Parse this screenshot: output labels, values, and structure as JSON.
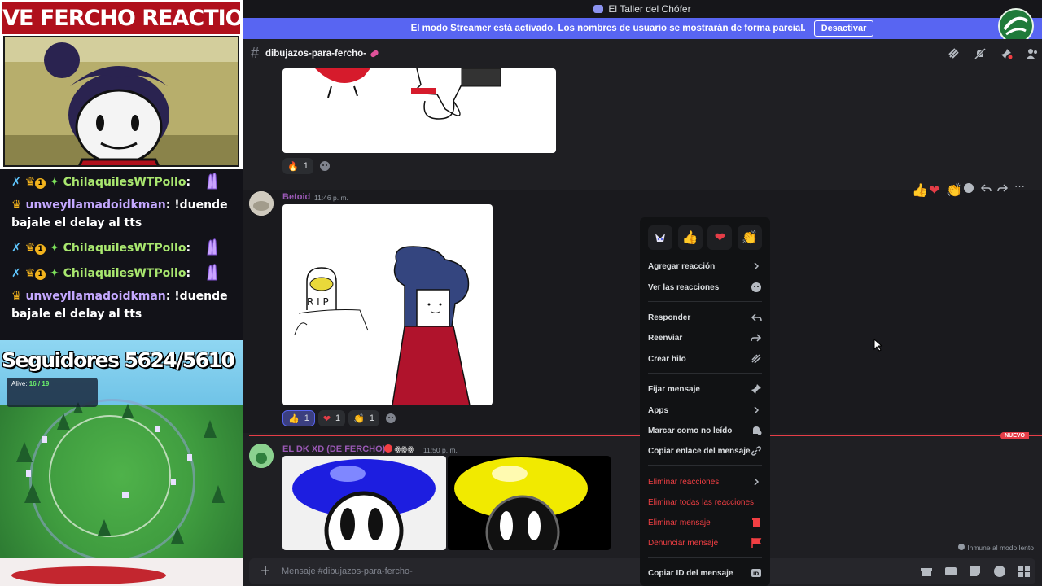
{
  "overlay": {
    "title": "LIVE FERCHO REACTION",
    "chat": [
      {
        "user": "ChilaquilesWTPollo",
        "message": "",
        "badges": "sword-crown-1-diamond"
      },
      {
        "user": "unweyllamadoidkman",
        "message": "!duende bajale el delay al tts",
        "badges": "crown"
      },
      {
        "user": "ChilaquilesWTPollo",
        "message": "",
        "badges": "sword-crown-1-diamond"
      },
      {
        "user": "ChilaquilesWTPollo",
        "message": "",
        "badges": "sword-crown-1-diamond"
      },
      {
        "user": "unweyllamadoidkman",
        "message": "!duende bajale el delay al tts",
        "badges": "crown"
      }
    ],
    "followers": "Seguidores 5624/5610",
    "alive_label": "Alive:",
    "alive_value": "16 / 19"
  },
  "window": {
    "title": "El Taller del Chófer"
  },
  "streamer_bar": {
    "text": "El modo Streamer está activado. Los nombres de usuario se mostrarán de forma parcial.",
    "button": "Desactivar"
  },
  "channel": {
    "name": "dibujazos-para-fercho-"
  },
  "messages": [
    {
      "reactions": [
        {
          "emoji": "fire",
          "count": "1"
        }
      ]
    },
    {
      "author": "Betoid",
      "author_color": "#9b59b6",
      "timestamp": "11:46 p. m.",
      "reactions": [
        {
          "emoji": "thumbs-up",
          "count": "1"
        },
        {
          "emoji": "heart",
          "count": "1"
        },
        {
          "emoji": "clap",
          "count": "1"
        }
      ]
    },
    {
      "author": "EL DK XD (DE FERCHO)",
      "author_color": "#9b59b6",
      "tag": "ꙮꙮꙮ",
      "timestamp": "11:50 p. m."
    }
  ],
  "new_badge": "NUEVO",
  "slowmode_note": "Inmune al modo lento",
  "composer": {
    "placeholder": "Mensaje #dibujazos-para-fercho-"
  },
  "context_menu": {
    "quick_emojis": [
      "custom-emoji",
      "thumbs-up",
      "heart",
      "clap"
    ],
    "items": [
      {
        "label": "Agregar reacción",
        "icon": "chevron-right-icon"
      },
      {
        "label": "Ver las reacciones",
        "icon": "emoji-icon"
      },
      {
        "label": "Responder",
        "icon": "reply-icon"
      },
      {
        "label": "Reenviar",
        "icon": "forward-icon"
      },
      {
        "label": "Crear hilo",
        "icon": "thread-icon"
      },
      {
        "label": "Fijar mensaje",
        "icon": "pin-icon"
      },
      {
        "label": "Apps",
        "icon": "chevron-right-icon"
      },
      {
        "label": "Marcar como no leído",
        "icon": "unread-icon"
      },
      {
        "label": "Copiar enlace del mensaje",
        "icon": "link-icon"
      },
      {
        "label": "Eliminar reacciones",
        "icon": "chevron-right-icon"
      },
      {
        "label": "Eliminar todas las reacciones",
        "icon": ""
      },
      {
        "label": "Eliminar mensaje",
        "icon": "trash-icon"
      },
      {
        "label": "Denunciar mensaje",
        "icon": "flag-icon"
      },
      {
        "label": "Copiar ID del mensaje",
        "icon": "id-icon"
      }
    ]
  },
  "colors": {
    "accent": "#5865f2",
    "danger": "#f23f43",
    "background": "#1f1f23"
  }
}
